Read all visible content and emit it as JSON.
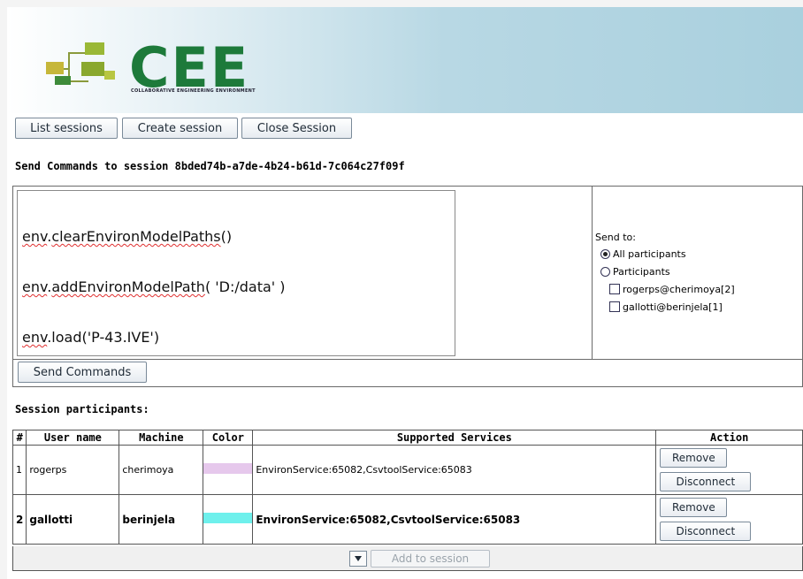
{
  "banner": {
    "logo_text": "CEE",
    "logo_subtitle": "COLLABORATIVE ENGINEERING ENVIRONMENT"
  },
  "toolbar": {
    "list_sessions": "List sessions",
    "create_session": "Create session",
    "close_session": "Close Session"
  },
  "commands": {
    "heading": "Send Commands to session 8bded74b-a7de-4b24-b61d-7c064c27f09f",
    "lines": [
      {
        "pre": "",
        "err": "env",
        "mid": ".",
        "err2": "clearEnvironModelPaths",
        "post": "()"
      },
      {
        "pre": "",
        "err": "env",
        "mid": ".",
        "err2": "addEnvironModelPath",
        "post": "( 'D:/data' )"
      },
      {
        "pre": "",
        "err": "env",
        "mid": ".load('P-43.IVE')",
        "err2": "",
        "post": ""
      }
    ],
    "send_button": "Send Commands"
  },
  "send_to": {
    "label": "Send to:",
    "all_participants": "All participants",
    "participants": "Participants",
    "participant_list": [
      "rogerps@cherimoya[2]",
      "gallotti@berinjela[1]"
    ]
  },
  "participants": {
    "heading": "Session participants:",
    "columns": [
      "#",
      "User name",
      "Machine",
      "Color",
      "Supported Services",
      "Action"
    ],
    "rows": [
      {
        "num": "1",
        "user": "rogerps",
        "machine": "cherimoya",
        "color": "#e6c8ec",
        "services": "EnvironService:65082,CsvtoolService:65083"
      },
      {
        "num": "2",
        "user": "gallotti",
        "machine": "berinjela",
        "color": "#6ef0ec",
        "services": "EnvironService:65082,CsvtoolService:65083"
      }
    ],
    "remove_label": "Remove",
    "disconnect_label": "Disconnect",
    "add_to_session": "Add to session"
  }
}
